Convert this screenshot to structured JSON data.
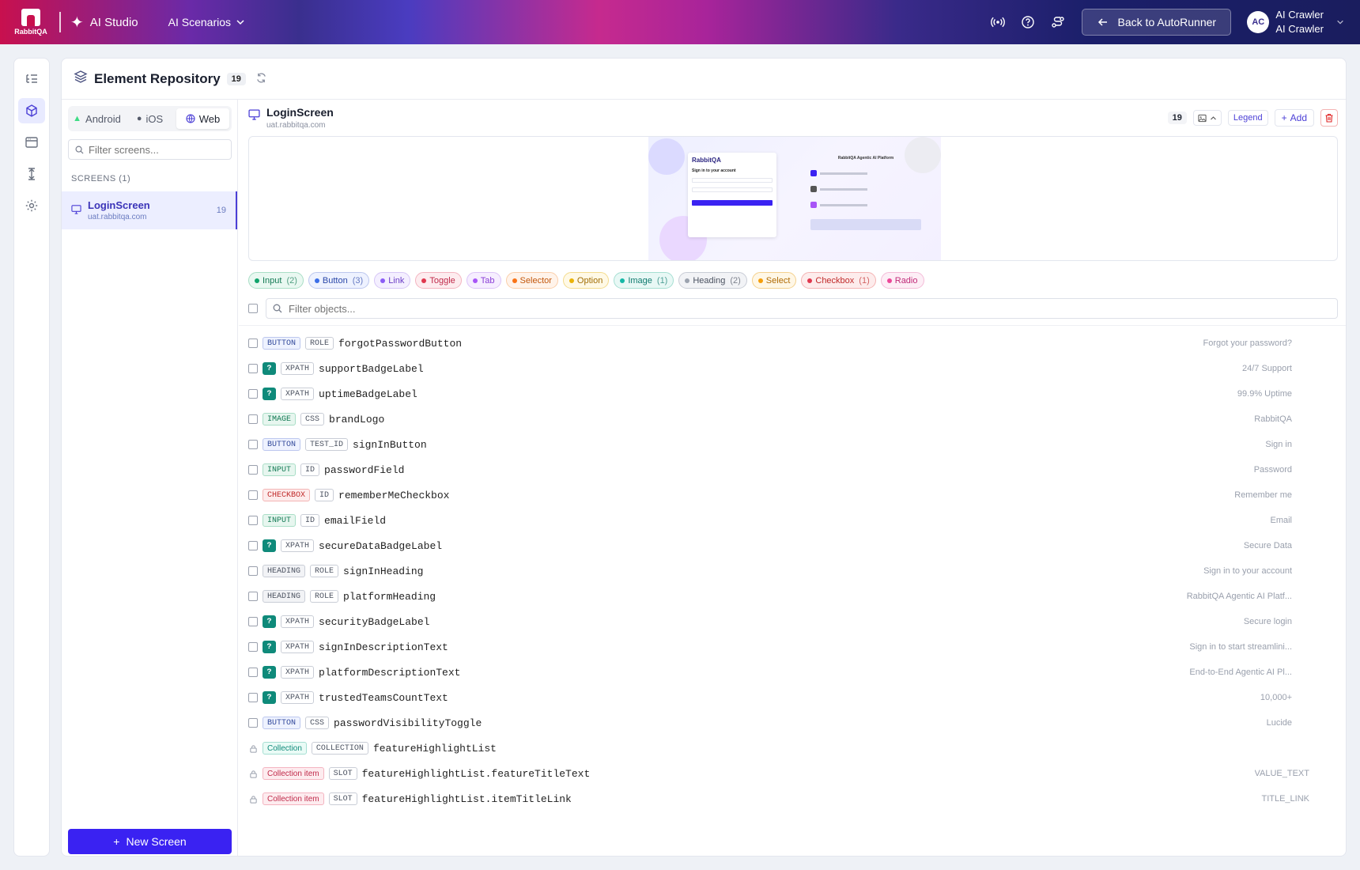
{
  "topbar": {
    "logo_text": "RabbitQA",
    "studio_label": "AI Studio",
    "scenarios_label": "AI Scenarios",
    "back_label": "Back to AutoRunner",
    "user_initials": "AC",
    "user_name": "AI Crawler",
    "user_role": "AI Crawler"
  },
  "repo": {
    "title": "Element Repository",
    "count": "19"
  },
  "sidebar": {
    "platform_tabs": [
      {
        "label": "Android",
        "icon": "android-icon"
      },
      {
        "label": "iOS",
        "icon": "apple-icon"
      },
      {
        "label": "Web",
        "icon": "globe-icon",
        "active": true
      }
    ],
    "filter_placeholder": "Filter screens...",
    "screens_label": "SCREENS (1)",
    "screens": [
      {
        "name": "LoginScreen",
        "url": "uat.rabbitqa.com",
        "count": "19"
      }
    ],
    "new_screen_label": "New Screen"
  },
  "screen": {
    "name": "LoginScreen",
    "url": "uat.rabbitqa.com",
    "count": "19",
    "legend_label": "Legend",
    "add_label": "Add"
  },
  "preview": {
    "logo": "RabbitQA",
    "heading": "Sign in to your account",
    "right_heading": "RabbitQA Agentic AI Platform"
  },
  "filters": [
    {
      "label": "Input",
      "count": "(2)",
      "color": "#10a36b",
      "bg": "#e9f8f1",
      "border": "#a9dec6",
      "text": "#137a54"
    },
    {
      "label": "Button",
      "count": "(3)",
      "color": "#3b6ee8",
      "bg": "#eef2ff",
      "border": "#bcc7ee",
      "text": "#2a47a8"
    },
    {
      "label": "Link",
      "count": "",
      "color": "#8b5cf6",
      "bg": "#f4efff",
      "border": "#d6c6f6",
      "text": "#6b3ec6"
    },
    {
      "label": "Toggle",
      "count": "",
      "color": "#e0384e",
      "bg": "#fdecef",
      "border": "#f4b4c0",
      "text": "#c02a4a"
    },
    {
      "label": "Tab",
      "count": "",
      "color": "#a855f7",
      "bg": "#f6eeff",
      "border": "#dcc4f8",
      "text": "#8a3ed6"
    },
    {
      "label": "Selector",
      "count": "",
      "color": "#f97316",
      "bg": "#fff3ea",
      "border": "#fbcfaa",
      "text": "#c2570c"
    },
    {
      "label": "Option",
      "count": "",
      "color": "#eab308",
      "bg": "#fff9e6",
      "border": "#f4dc8e",
      "text": "#a16d05"
    },
    {
      "label": "Image",
      "count": "(1)",
      "color": "#14b8a6",
      "bg": "#e8f8f5",
      "border": "#a6dfd2",
      "text": "#0f7a6e"
    },
    {
      "label": "Heading",
      "count": "(2)",
      "color": "#9ca3af",
      "bg": "#f2f3f6",
      "border": "#c9cdd6",
      "text": "#4b5260"
    },
    {
      "label": "Select",
      "count": "",
      "color": "#f59e0b",
      "bg": "#fff7e6",
      "border": "#f4d18e",
      "text": "#b06b05"
    },
    {
      "label": "Checkbox",
      "count": "(1)",
      "color": "#e0384e",
      "bg": "#fdecec",
      "border": "#f4b4b4",
      "text": "#c02a2a"
    },
    {
      "label": "Radio",
      "count": "",
      "color": "#ec4899",
      "bg": "#fdeef6",
      "border": "#f4bcd8",
      "text": "#c02a78"
    }
  ],
  "object_filter_placeholder": "Filter objects...",
  "objects": [
    {
      "type": "BUTTON",
      "type_class": "b-button",
      "strategy": "ROLE",
      "name": "forgotPasswordButton",
      "value": "Forgot your password?"
    },
    {
      "type": "?",
      "type_class": "b-q",
      "strategy": "XPATH",
      "name": "supportBadgeLabel",
      "value": "24/7 Support"
    },
    {
      "type": "?",
      "type_class": "b-q",
      "strategy": "XPATH",
      "name": "uptimeBadgeLabel",
      "value": "99.9% Uptime"
    },
    {
      "type": "IMAGE",
      "type_class": "b-image",
      "strategy": "CSS",
      "name": "brandLogo",
      "value": "RabbitQA"
    },
    {
      "type": "BUTTON",
      "type_class": "b-button",
      "strategy": "TEST_ID",
      "name": "signInButton",
      "value": "Sign in"
    },
    {
      "type": "INPUT",
      "type_class": "b-input",
      "strategy": "ID",
      "name": "passwordField",
      "value": "Password"
    },
    {
      "type": "CHECKBOX",
      "type_class": "b-checkbox",
      "strategy": "ID",
      "name": "rememberMeCheckbox",
      "value": "Remember me"
    },
    {
      "type": "INPUT",
      "type_class": "b-input",
      "strategy": "ID",
      "name": "emailField",
      "value": "Email"
    },
    {
      "type": "?",
      "type_class": "b-q",
      "strategy": "XPATH",
      "name": "secureDataBadgeLabel",
      "value": "Secure Data"
    },
    {
      "type": "HEADING",
      "type_class": "b-heading",
      "strategy": "ROLE",
      "name": "signInHeading",
      "value": "Sign in to your account"
    },
    {
      "type": "HEADING",
      "type_class": "b-heading",
      "strategy": "ROLE",
      "name": "platformHeading",
      "value": "RabbitQA Agentic AI Platf..."
    },
    {
      "type": "?",
      "type_class": "b-q",
      "strategy": "XPATH",
      "name": "securityBadgeLabel",
      "value": "Secure login"
    },
    {
      "type": "?",
      "type_class": "b-q",
      "strategy": "XPATH",
      "name": "signInDescriptionText",
      "value": "Sign in to start streamlini..."
    },
    {
      "type": "?",
      "type_class": "b-q",
      "strategy": "XPATH",
      "name": "platformDescriptionText",
      "value": "End-to-End Agentic AI Pl..."
    },
    {
      "type": "?",
      "type_class": "b-q",
      "strategy": "XPATH",
      "name": "trustedTeamsCountText",
      "value": "10,000+"
    },
    {
      "type": "BUTTON",
      "type_class": "b-button",
      "strategy": "CSS",
      "name": "passwordVisibilityToggle",
      "value": "Lucide"
    },
    {
      "type": "Collection",
      "type_class": "b-coll",
      "strategy": "COLLECTION",
      "name": "featureHighlightList",
      "value": "",
      "locked": true
    },
    {
      "type": "Collection item",
      "type_class": "b-citem",
      "strategy": "SLOT",
      "name": "featureHighlightList.featureTitleText",
      "value": "VALUE_TEXT",
      "locked": true
    },
    {
      "type": "Collection item",
      "type_class": "b-citem",
      "strategy": "SLOT",
      "name": "featureHighlightList.itemTitleLink",
      "value": "TITLE_LINK",
      "locked": true
    }
  ]
}
